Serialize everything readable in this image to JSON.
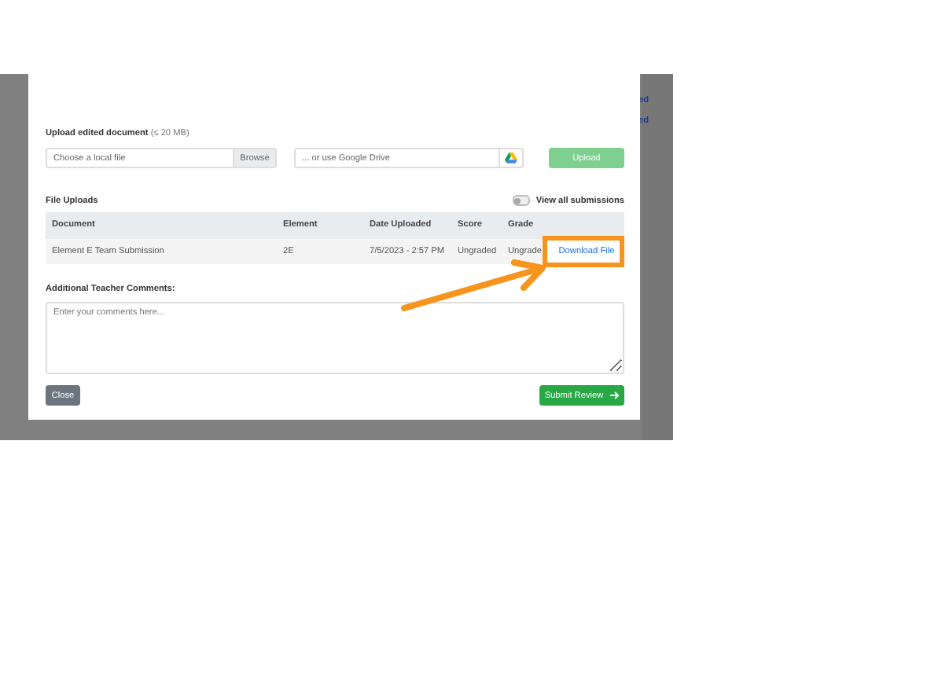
{
  "background_page": {
    "row_fragments": [
      "ed",
      "ed"
    ]
  },
  "modal": {
    "upload": {
      "label": "Upload edited document",
      "limit": "(≤ 20 MB)",
      "file_placeholder": "Choose a local file",
      "browse": "Browse",
      "drive_placeholder": "... or use Google Drive",
      "upload_button": "Upload",
      "upload_disabled": true
    },
    "file_uploads": {
      "title": "File Uploads",
      "toggle": {
        "label": "View all submissions",
        "on": false
      },
      "table": {
        "columns": [
          "Document",
          "Element",
          "Date Uploaded",
          "Score",
          "Grade"
        ],
        "rows": [
          {
            "cells": [
              "Element E Team Submission",
              "2E",
              "7/5/2023 - 2:57 PM",
              "Ungraded",
              "Ungrade"
            ],
            "link": "Download File",
            "highlighted": true
          }
        ]
      }
    },
    "comments": {
      "label": "Additional Teacher Comments:",
      "placeholder": "Enter your comments here..."
    },
    "buttons": {
      "close": "Close",
      "submit": "Submit Review"
    }
  }
}
